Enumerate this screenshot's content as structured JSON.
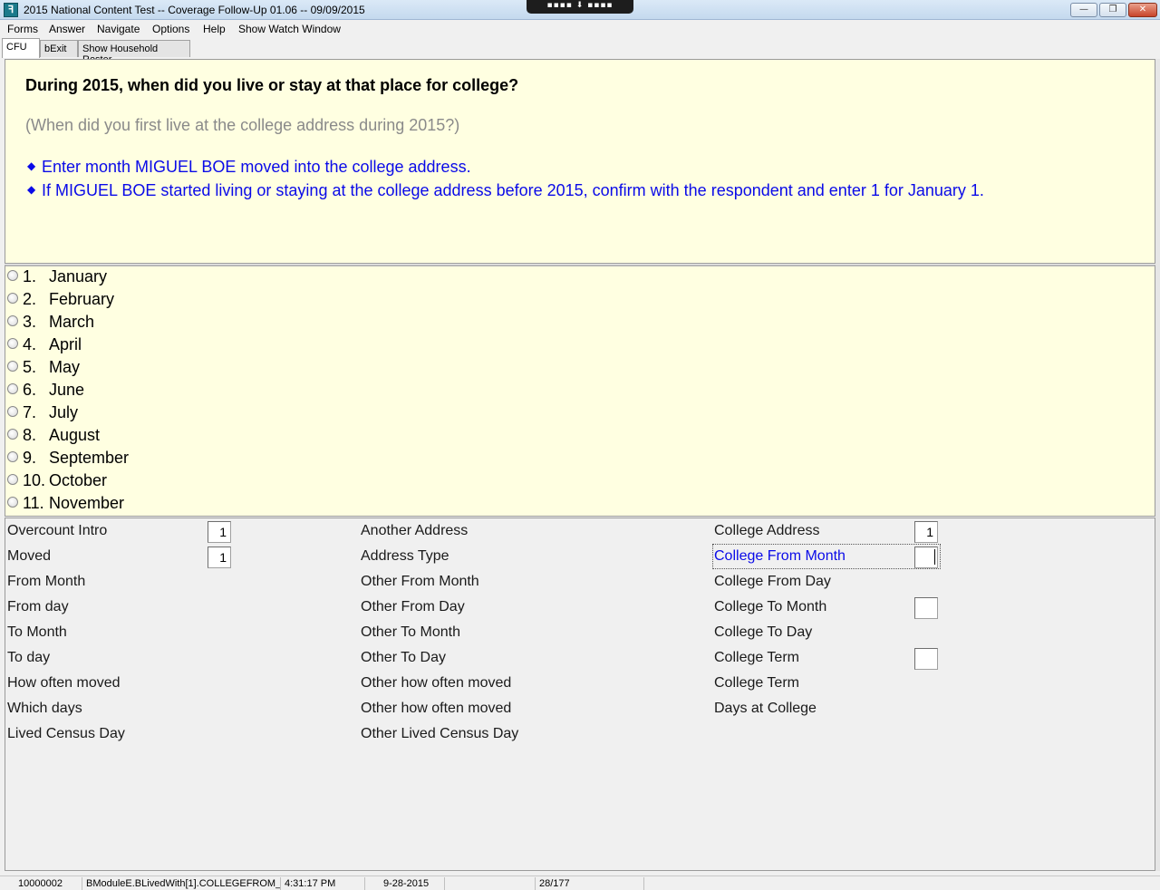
{
  "window": {
    "title": "2015 National Content Test -- Coverage Follow-Up 01.06 -- 09/09/2015",
    "remote_bar": "▪▪▪▪ ⬇ ▪▪▪▪",
    "minimize": "—",
    "restore": "❐",
    "close": "✕"
  },
  "menu": [
    "Forms",
    "Answer",
    "Navigate",
    "Options",
    "Help",
    "Show Watch Window"
  ],
  "tabs": [
    "CFU",
    "bExit",
    "Show Household Roster"
  ],
  "question": {
    "text": "During 2015, when did you live or stay at that place for college?",
    "probe": "(When did you first live at the college address during 2015?)",
    "instructions": [
      "Enter month MIGUEL BOE moved into the college address.",
      "If MIGUEL BOE started living or staying at the college address before 2015, confirm with the respondent and enter 1 for January 1."
    ]
  },
  "answers": [
    {
      "code": "1.",
      "label": "January"
    },
    {
      "code": "2.",
      "label": "February"
    },
    {
      "code": "3.",
      "label": "March"
    },
    {
      "code": "4.",
      "label": "April"
    },
    {
      "code": "5.",
      "label": "May"
    },
    {
      "code": "6.",
      "label": "June"
    },
    {
      "code": "7.",
      "label": "July"
    },
    {
      "code": "8.",
      "label": "August"
    },
    {
      "code": "9.",
      "label": "September"
    },
    {
      "code": "10.",
      "label": "October"
    },
    {
      "code": "11.",
      "label": "November"
    }
  ],
  "fields": {
    "col1": [
      {
        "label": "Overcount Intro",
        "value": "1"
      },
      {
        "label": "Moved",
        "value": "1"
      },
      {
        "label": "From Month"
      },
      {
        "label": "From day"
      },
      {
        "label": "To Month"
      },
      {
        "label": "To day"
      },
      {
        "label": "How often moved"
      },
      {
        "label": "Which days"
      },
      {
        "label": "Lived Census Day"
      }
    ],
    "col2": [
      {
        "label": "Another Address"
      },
      {
        "label": "Address Type"
      },
      {
        "label": "Other From Month"
      },
      {
        "label": "Other From Day"
      },
      {
        "label": "Other To Month"
      },
      {
        "label": "Other To Day"
      },
      {
        "label": "Other how often moved"
      },
      {
        "label": "Other how often moved"
      },
      {
        "label": "Other Lived Census Day"
      }
    ],
    "col3": [
      {
        "label": "College Address",
        "value": "1"
      },
      {
        "label": "College From Month",
        "value": ""
      },
      {
        "label": "College From Day"
      },
      {
        "label": "College To Month",
        "value": ""
      },
      {
        "label": "College To Day"
      },
      {
        "label": "College Term",
        "value": ""
      },
      {
        "label": "College Term"
      },
      {
        "label": "Days at College"
      }
    ]
  },
  "status": {
    "case_id": "10000002",
    "field_path": "BModuleE.BLivedWith[1].COLLEGEFROM_M",
    "time": "4:31:17 PM",
    "date": "9-28-2015",
    "page": "28/177"
  },
  "colors": {
    "question_bg": "#ffffe1",
    "instruction_blue": "#0a0ae8",
    "probe_gray": "#8a8a8a"
  }
}
